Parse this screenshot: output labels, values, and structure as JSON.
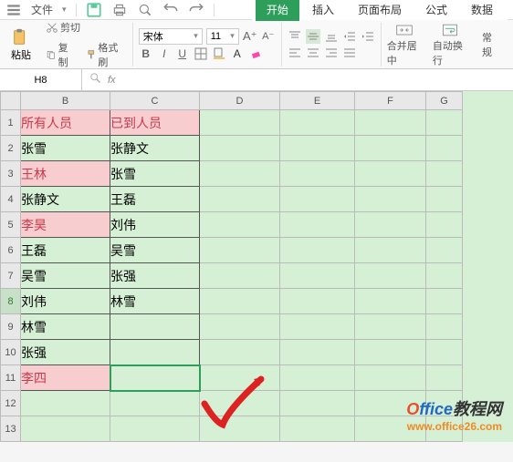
{
  "menubar": {
    "file": "文件"
  },
  "tabs": {
    "start": "开始",
    "insert": "插入",
    "layout": "页面布局",
    "formula": "公式",
    "data": "数据"
  },
  "ribbon": {
    "cut": "剪切",
    "copy": "复制",
    "format_painter": "格式刷",
    "paste": "粘贴",
    "font_name": "宋体",
    "font_size": "11",
    "merge": "合并居中",
    "wrap": "自动换行",
    "normal": "常规"
  },
  "namebox": "H8",
  "cols": [
    "B",
    "C",
    "D",
    "E",
    "F",
    "G"
  ],
  "rows": [
    {
      "n": 1,
      "b": "所有人员",
      "c": "已到人员",
      "hdr": true
    },
    {
      "n": 2,
      "b": "张雪",
      "c": "张静文"
    },
    {
      "n": 3,
      "b": "王林",
      "c": "张雪",
      "hl": true
    },
    {
      "n": 4,
      "b": "张静文",
      "c": "王磊"
    },
    {
      "n": 5,
      "b": "李昊",
      "c": "刘伟",
      "hl": true
    },
    {
      "n": 6,
      "b": "王磊",
      "c": "吴雪"
    },
    {
      "n": 7,
      "b": "吴雪",
      "c": "张强"
    },
    {
      "n": 8,
      "b": "刘伟",
      "c": "林雪",
      "sel": true
    },
    {
      "n": 9,
      "b": "林雪",
      "c": ""
    },
    {
      "n": 10,
      "b": "张强",
      "c": ""
    },
    {
      "n": 11,
      "b": "李四",
      "c": "",
      "hl": true,
      "selC": true
    },
    {
      "n": 12,
      "b": "",
      "c": "",
      "plain": true
    },
    {
      "n": 13,
      "b": "",
      "c": "",
      "plain": true
    }
  ],
  "watermark": {
    "brand_o": "O",
    "brand_rest": "ffice",
    "brand_cn": "教程网",
    "url": "www.office26.com"
  }
}
